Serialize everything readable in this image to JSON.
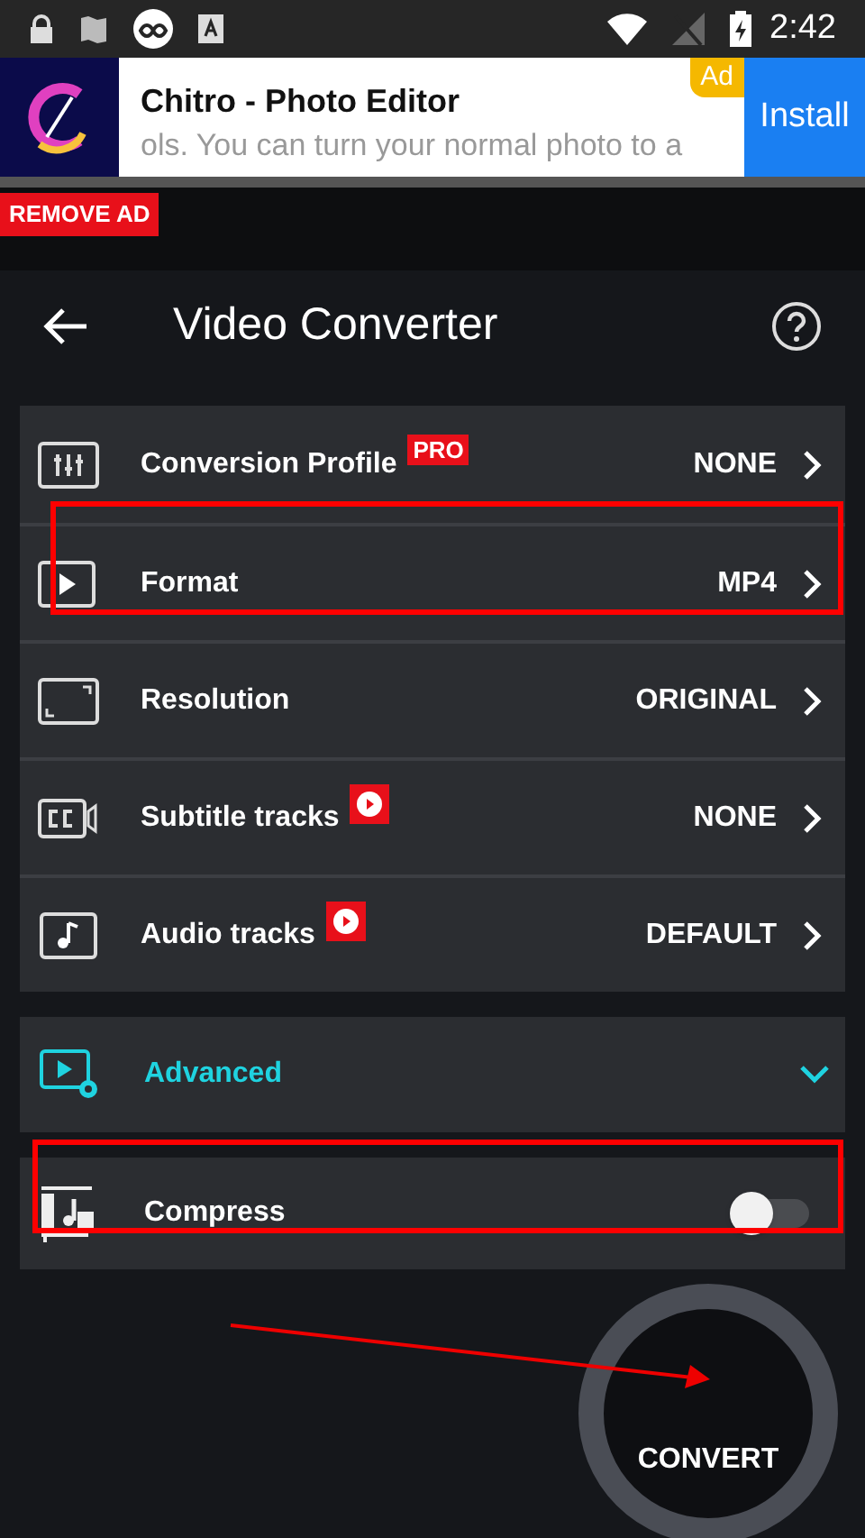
{
  "status_bar": {
    "time": "2:42"
  },
  "ad": {
    "title": "Chitro - Photo Editor",
    "text": "ols. You can turn your normal photo to a",
    "badge": "Ad",
    "button": "Install"
  },
  "remove_ad": "REMOVE AD",
  "header": {
    "title": "Video Converter"
  },
  "settings": [
    {
      "kind": "sliders",
      "label": "Conversion Profile",
      "badge": {
        "kind": "text",
        "text": "PRO"
      },
      "value": "NONE"
    },
    {
      "kind": "play",
      "label": "Format",
      "value": "MP4"
    },
    {
      "kind": "frame",
      "label": "Resolution",
      "value": "ORIGINAL"
    },
    {
      "kind": "cc",
      "label": "Subtitle tracks",
      "badge": {
        "kind": "video"
      },
      "value": "NONE"
    },
    {
      "kind": "music",
      "label": "Audio tracks",
      "badge": {
        "kind": "video"
      },
      "value": "DEFAULT"
    }
  ],
  "advanced": {
    "label": "Advanced",
    "expanded": false
  },
  "compress": {
    "label": "Compress",
    "on": false
  },
  "convert": {
    "label": "CONVERT"
  }
}
